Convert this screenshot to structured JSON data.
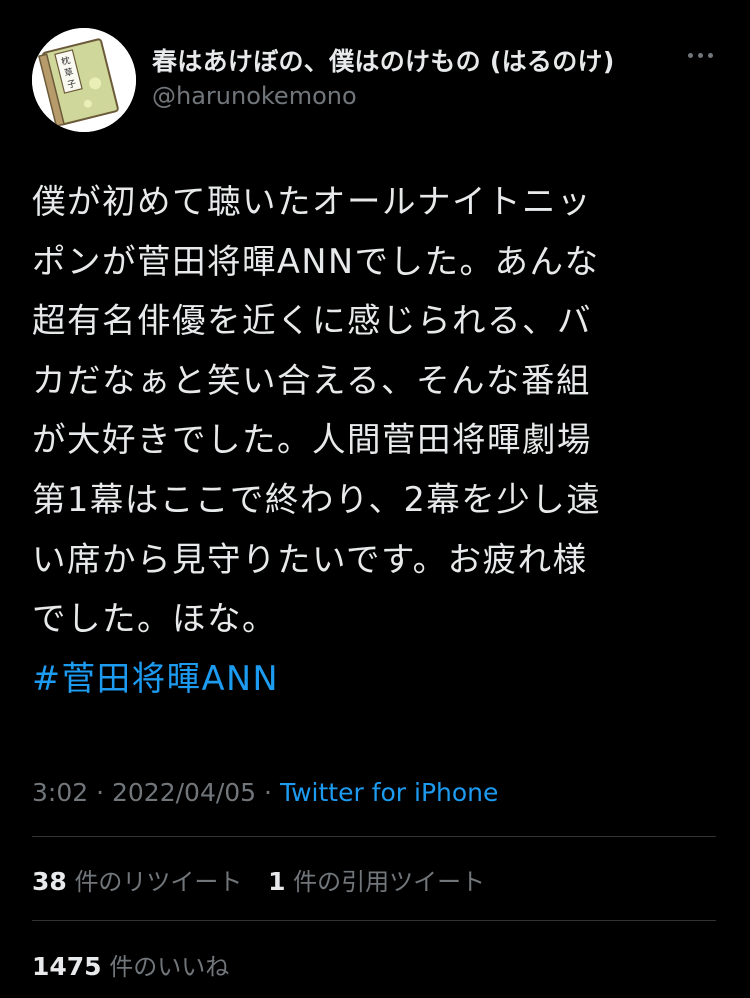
{
  "user": {
    "display_name": "春はあけぼの、僕はのけもの (はるのけ)",
    "handle": "@harunokemono",
    "avatar_text": "枕草子"
  },
  "tweet": {
    "lines": [
      "僕が初めて聴いたオールナイトニッ",
      "ポンが菅田将暉ANNでした。あんな",
      "超有名俳優を近くに感じられる、バ",
      "カだなぁと笑い合える、そんな番組",
      "が大好きでした。人間菅田将暉劇場",
      "第1幕はここで終わり、2幕を少し遠",
      "い席から見守りたいです。お疲れ様",
      "でした。ほな。"
    ],
    "hashtag": "#菅田将暉ANN",
    "time": "3:02",
    "separator": "·",
    "date": "2022/04/05",
    "source": "Twitter for iPhone"
  },
  "stats": {
    "retweets_count": "38",
    "retweets_label": "件のリツイート",
    "quotes_count": "1",
    "quotes_label": "件の引用ツイート",
    "likes_count": "1475",
    "likes_label": "件のいいね"
  },
  "icons": {
    "more": "more-icon"
  }
}
